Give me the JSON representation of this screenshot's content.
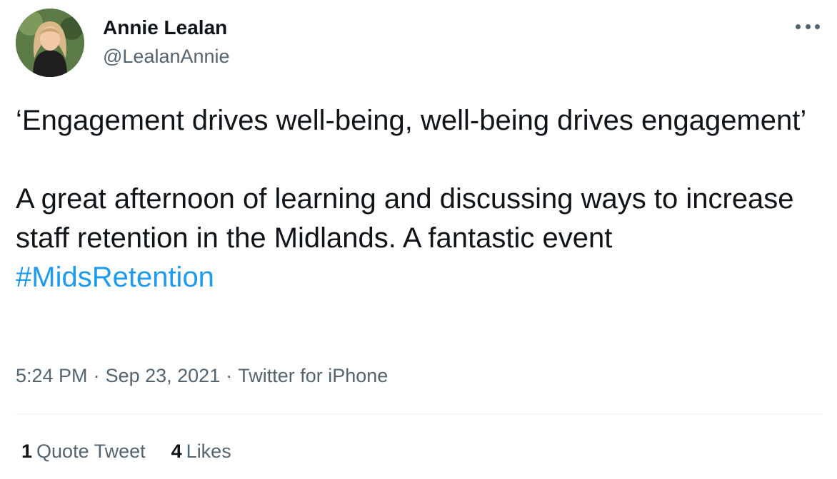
{
  "author": {
    "name": "Annie Lealan",
    "handle": "@LealanAnnie"
  },
  "more_icon": "ellipsis-icon",
  "tweet": {
    "quote_line": "‘Engagement drives well-being, well-being drives engagement’",
    "paragraph": "A great afternoon of learning and discussing ways to increase staff retention in the Midlands. A fantastic event ",
    "hashtag": "#MidsRetention"
  },
  "meta": {
    "time": "5:24 PM",
    "date": "Sep 23, 2021",
    "source": "Twitter for iPhone",
    "separator": "·"
  },
  "stats": {
    "quote_tweets_count": "1",
    "quote_tweets_label": "Quote Tweet",
    "likes_count": "4",
    "likes_label": "Likes"
  },
  "colors": {
    "accent": "#1d9bf0",
    "text": "#0f1419",
    "secondary": "#536471",
    "divider": "#eff3f4"
  }
}
